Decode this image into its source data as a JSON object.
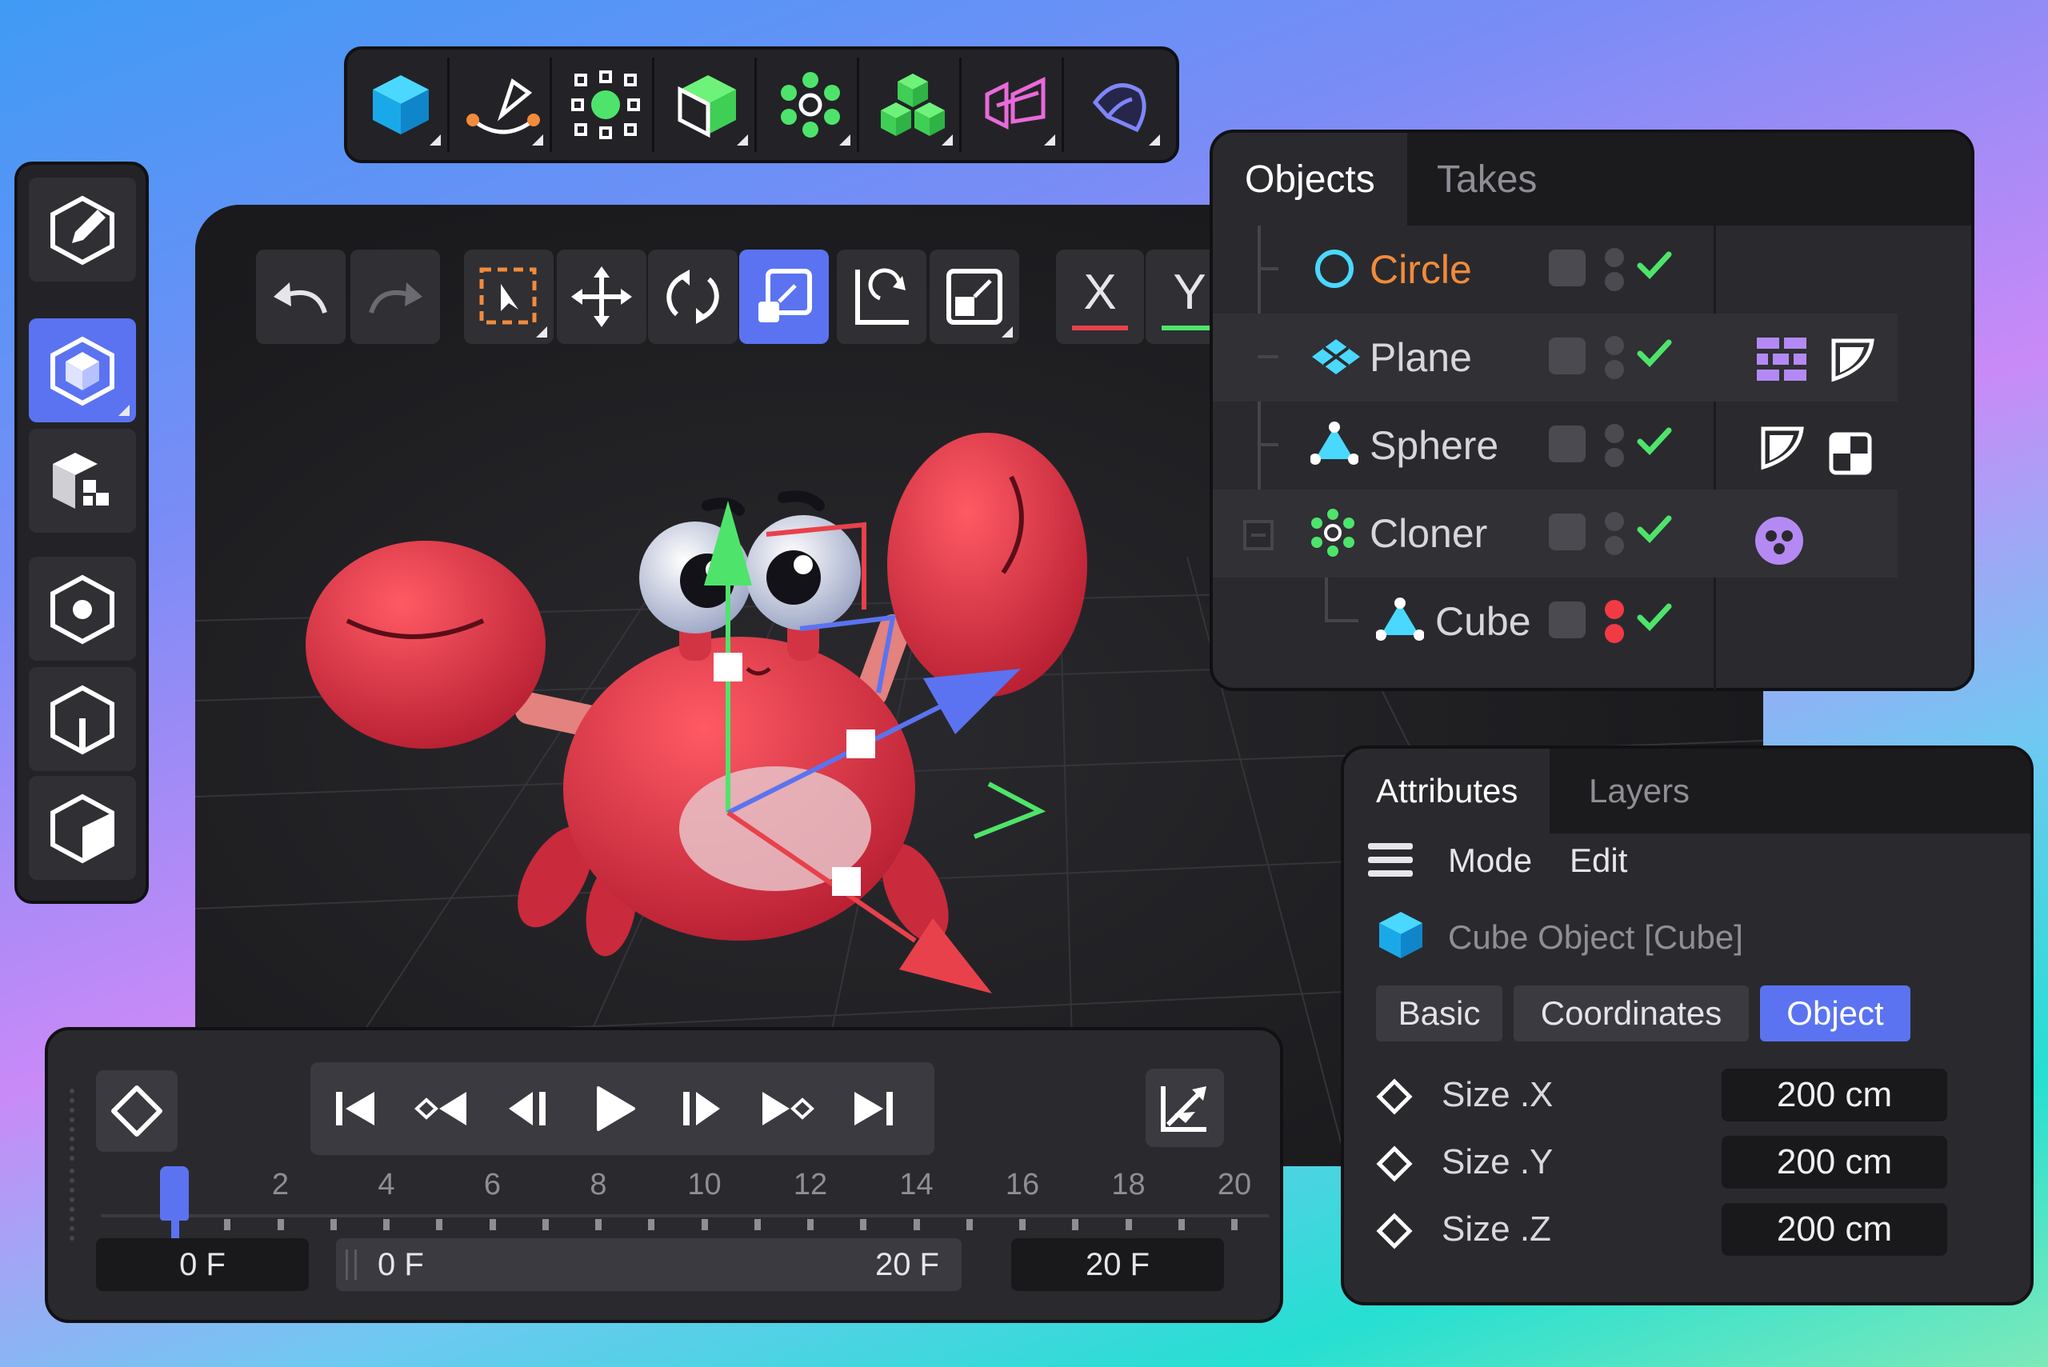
{
  "top_toolbar": {
    "tools": [
      {
        "icon": "cube-primitive-icon"
      },
      {
        "icon": "pen-spline-icon"
      },
      {
        "icon": "selection-generator-icon"
      },
      {
        "icon": "extrude-cube-icon"
      },
      {
        "icon": "cloner-gear-icon"
      },
      {
        "icon": "stacked-cubes-icon"
      },
      {
        "icon": "deformer-icon"
      },
      {
        "icon": "field-icon"
      }
    ]
  },
  "left_toolbar": {
    "tools": [
      {
        "icon": "edit-mode-icon"
      },
      {
        "icon": "model-mode-icon",
        "active": true
      },
      {
        "icon": "texture-mode-icon"
      },
      {
        "icon": "point-mode-icon"
      },
      {
        "icon": "edge-mode-icon"
      },
      {
        "icon": "polygon-mode-icon"
      }
    ]
  },
  "viewport": {
    "tools": [
      {
        "icon": "undo-icon"
      },
      {
        "icon": "redo-icon"
      },
      {
        "icon": "live-selection-icon"
      },
      {
        "icon": "move-icon"
      },
      {
        "icon": "rotate-icon"
      },
      {
        "icon": "scale-icon",
        "active": true
      },
      {
        "icon": "rotate-axis-icon"
      },
      {
        "icon": "scale-axis-icon"
      }
    ],
    "axis_x": "X",
    "axis_y": "Y",
    "axis_colors": {
      "x": "#e8414b",
      "y": "#4ee46b",
      "z": "#5b73f1"
    }
  },
  "objects_panel": {
    "tabs": [
      "Objects",
      "Takes"
    ],
    "rows": [
      {
        "name": "Circle",
        "icon": "circle-spline-icon",
        "highlight": true,
        "status": "green"
      },
      {
        "name": "Plane",
        "icon": "plane-icon",
        "status": "green"
      },
      {
        "name": "Sphere",
        "icon": "sphere-icon",
        "status": "green"
      },
      {
        "name": "Cloner",
        "icon": "cloner-icon",
        "status": "green"
      },
      {
        "name": "Cube",
        "icon": "cube-icon",
        "status": "red"
      }
    ],
    "colors": {
      "highlight": "#f28b3a",
      "check": "#4ee46b",
      "red_dot": "#f23a45",
      "tag": "#b589f4"
    }
  },
  "attributes_panel": {
    "tabs": [
      "Attributes",
      "Layers"
    ],
    "menu": [
      "Mode",
      "Edit"
    ],
    "object_title": "Cube Object [Cube]",
    "subtabs": [
      "Basic",
      "Coordinates",
      "Object"
    ],
    "active_subtab": "Object",
    "properties": [
      {
        "label": "Size .X",
        "value": "200 cm"
      },
      {
        "label": "Size .Y",
        "value": "200 cm"
      },
      {
        "label": "Size .Z",
        "value": "200 cm"
      }
    ]
  },
  "timeline": {
    "ticks": [
      "0",
      "2",
      "4",
      "6",
      "8",
      "10",
      "12",
      "14",
      "16",
      "18",
      "20"
    ],
    "current_frame": "0 F",
    "range_start": "0 F",
    "range_end": "20 F",
    "end_frame": "20 F",
    "playhead_frame": 0
  }
}
